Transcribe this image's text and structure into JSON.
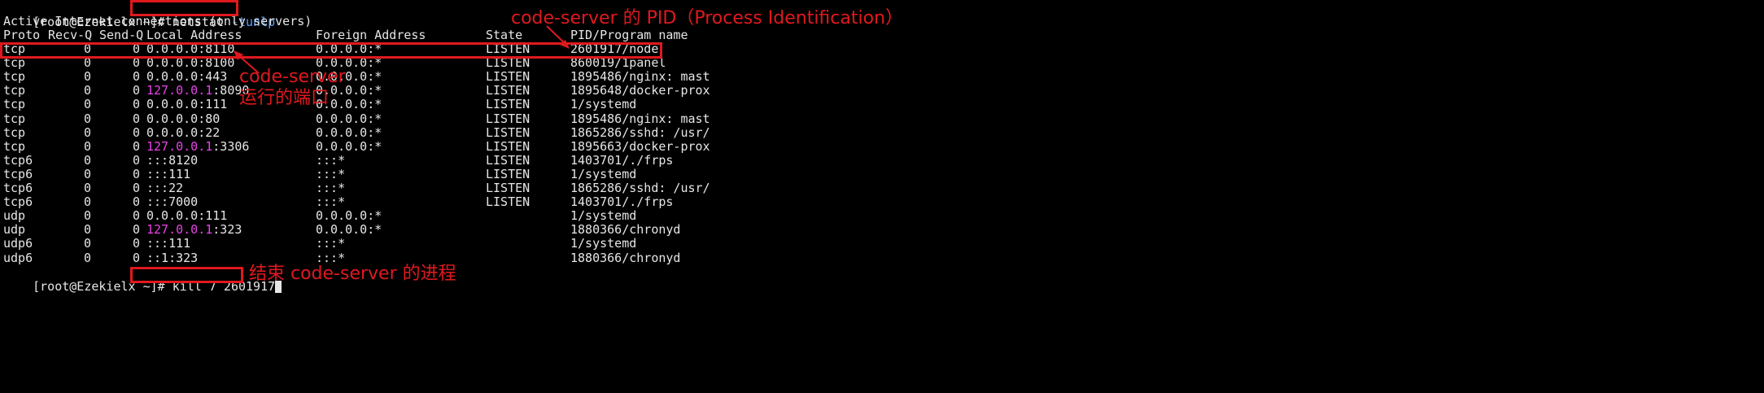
{
  "terminal": {
    "prompt": "[root@Ezekielx ~]#",
    "command1_name": "netstat",
    "command1_flags": "-tunlp",
    "header_title": "Active Internet connections (only servers)",
    "columns": {
      "proto": "Proto",
      "recvq": "Recv-Q",
      "sendq": "Send-Q",
      "local": "Local Address",
      "foreign": "Foreign Address",
      "state": "State",
      "pid": "PID/Program name"
    },
    "rows": [
      {
        "proto": "tcp",
        "recvq": "0",
        "sendq": "0",
        "local_ip": "0.0.0.0",
        "local_port": ":8110",
        "foreign": "0.0.0.0:*",
        "state": "LISTEN",
        "pid": "2601917/node"
      },
      {
        "proto": "tcp",
        "recvq": "0",
        "sendq": "0",
        "local_ip": "0.0.0.0",
        "local_port": ":8100",
        "foreign": "0.0.0.0:*",
        "state": "LISTEN",
        "pid": "860019/1panel"
      },
      {
        "proto": "tcp",
        "recvq": "0",
        "sendq": "0",
        "local_ip": "0.0.0.0",
        "local_port": ":443",
        "foreign": "0.0.0.0:*",
        "state": "LISTEN",
        "pid": "1895486/nginx: mast"
      },
      {
        "proto": "tcp",
        "recvq": "0",
        "sendq": "0",
        "local_ip": "127.0.0.1",
        "local_port": ":8090",
        "foreign": "0.0.0.0:*",
        "state": "LISTEN",
        "pid": "1895648/docker-prox"
      },
      {
        "proto": "tcp",
        "recvq": "0",
        "sendq": "0",
        "local_ip": "0.0.0.0",
        "local_port": ":111",
        "foreign": "0.0.0.0:*",
        "state": "LISTEN",
        "pid": "1/systemd"
      },
      {
        "proto": "tcp",
        "recvq": "0",
        "sendq": "0",
        "local_ip": "0.0.0.0",
        "local_port": ":80",
        "foreign": "0.0.0.0:*",
        "state": "LISTEN",
        "pid": "1895486/nginx: mast"
      },
      {
        "proto": "tcp",
        "recvq": "0",
        "sendq": "0",
        "local_ip": "0.0.0.0",
        "local_port": ":22",
        "foreign": "0.0.0.0:*",
        "state": "LISTEN",
        "pid": "1865286/sshd: /usr/"
      },
      {
        "proto": "tcp",
        "recvq": "0",
        "sendq": "0",
        "local_ip": "127.0.0.1",
        "local_port": ":3306",
        "foreign": "0.0.0.0:*",
        "state": "LISTEN",
        "pid": "1895663/docker-prox"
      },
      {
        "proto": "tcp6",
        "recvq": "0",
        "sendq": "0",
        "local_ip": "",
        "local_port": ":::8120",
        "foreign": ":::*",
        "state": "LISTEN",
        "pid": "1403701/./frps"
      },
      {
        "proto": "tcp6",
        "recvq": "0",
        "sendq": "0",
        "local_ip": "",
        "local_port": ":::111",
        "foreign": ":::*",
        "state": "LISTEN",
        "pid": "1/systemd"
      },
      {
        "proto": "tcp6",
        "recvq": "0",
        "sendq": "0",
        "local_ip": "",
        "local_port": ":::22",
        "foreign": ":::*",
        "state": "LISTEN",
        "pid": "1865286/sshd: /usr/"
      },
      {
        "proto": "tcp6",
        "recvq": "0",
        "sendq": "0",
        "local_ip": "",
        "local_port": ":::7000",
        "foreign": ":::*",
        "state": "LISTEN",
        "pid": "1403701/./frps"
      },
      {
        "proto": "udp",
        "recvq": "0",
        "sendq": "0",
        "local_ip": "0.0.0.0",
        "local_port": ":111",
        "foreign": "0.0.0.0:*",
        "state": "",
        "pid": "1/systemd"
      },
      {
        "proto": "udp",
        "recvq": "0",
        "sendq": "0",
        "local_ip": "127.0.0.1",
        "local_port": ":323",
        "foreign": "0.0.0.0:*",
        "state": "",
        "pid": "1880366/chronyd"
      },
      {
        "proto": "udp6",
        "recvq": "0",
        "sendq": "0",
        "local_ip": "",
        "local_port": ":::111",
        "foreign": ":::*",
        "state": "",
        "pid": "1/systemd"
      },
      {
        "proto": "udp6",
        "recvq": "0",
        "sendq": "0",
        "local_ip": "",
        "local_port": "::1:323",
        "foreign": ":::*",
        "state": "",
        "pid": "1880366/chronyd"
      }
    ],
    "command2": "kill 7 2601917"
  },
  "annotations": {
    "pid_note": "code-server 的 PID（Process Identification）",
    "port_note_line1": "code-server",
    "port_note_line2": "运行的端口",
    "kill_note": "结束 code-server 的进程"
  },
  "colors": {
    "annotation_red": "#e0191e",
    "local_ip_magenta": "#e843e8",
    "flag_blue": "#5aa0ff",
    "background": "#000000",
    "text": "#e6e6e6"
  }
}
